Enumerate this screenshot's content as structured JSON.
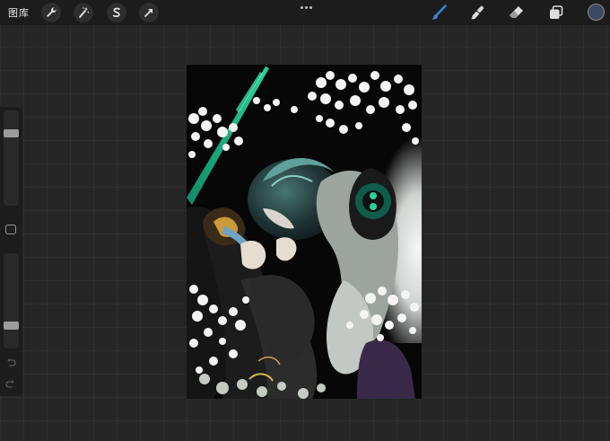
{
  "topbar": {
    "gallery_label": "图库",
    "left_tools": [
      {
        "name": "actions-wrench-icon"
      },
      {
        "name": "adjustments-wand-icon"
      },
      {
        "name": "selection-s-icon"
      },
      {
        "name": "transform-arrow-icon"
      }
    ],
    "right_tools": [
      {
        "name": "brush-icon"
      },
      {
        "name": "smudge-icon"
      },
      {
        "name": "eraser-icon"
      },
      {
        "name": "layers-icon"
      }
    ],
    "active_color": "#3a4a63",
    "active_tool_color": "#3b82d6"
  },
  "sidebar": {
    "brush_size_level": 0.78,
    "opacity_level": 0.22
  },
  "canvas": {
    "artwork": "anime-illustration-embrace-cherry-blossoms"
  }
}
